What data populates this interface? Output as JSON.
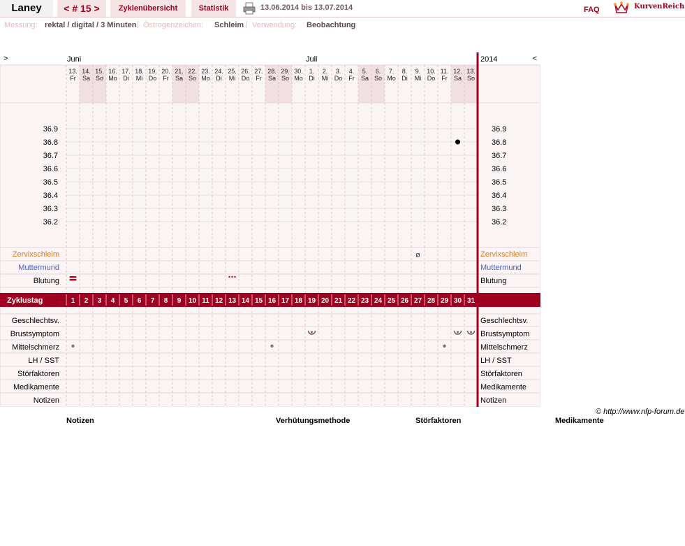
{
  "header": {
    "user_name": "Laney",
    "cycle_nav": "< # 15 >",
    "cycle_overview": "Zyklenübersicht",
    "statistics": "Statistik",
    "date_range": "13.06.2014 bis 13.07.2014",
    "faq": "FAQ",
    "brand": "KurvenReich"
  },
  "meta": {
    "measurement_label": "Messung:",
    "measurement_value": "rektal / digital / 3 Minuten",
    "estrogen_label": "Östrogenzeichen:",
    "estrogen_value": "Schleim",
    "usage_label": "Verwendung:",
    "usage_value": "Beobachtung"
  },
  "chart": {
    "nav_prev": ">",
    "nav_next": "<",
    "year": "2014",
    "months": [
      {
        "label": "Juni",
        "col": 0
      },
      {
        "label": "Juli",
        "col": 18
      }
    ],
    "days": [
      {
        "d": "13.",
        "w": "Fr"
      },
      {
        "d": "14.",
        "w": "Sa"
      },
      {
        "d": "15.",
        "w": "So"
      },
      {
        "d": "16.",
        "w": "Mo"
      },
      {
        "d": "17.",
        "w": "Di"
      },
      {
        "d": "18.",
        "w": "Mi"
      },
      {
        "d": "19.",
        "w": "Do"
      },
      {
        "d": "20.",
        "w": "Fr"
      },
      {
        "d": "21.",
        "w": "Sa"
      },
      {
        "d": "22.",
        "w": "So"
      },
      {
        "d": "23.",
        "w": "Mo"
      },
      {
        "d": "24.",
        "w": "Di"
      },
      {
        "d": "25.",
        "w": "Mi"
      },
      {
        "d": "26.",
        "w": "Do"
      },
      {
        "d": "27.",
        "w": "Fr"
      },
      {
        "d": "28.",
        "w": "Sa"
      },
      {
        "d": "29.",
        "w": "So"
      },
      {
        "d": "30.",
        "w": "Mo"
      },
      {
        "d": "1.",
        "w": "Di"
      },
      {
        "d": "2.",
        "w": "Mi"
      },
      {
        "d": "3.",
        "w": "Do"
      },
      {
        "d": "4.",
        "w": "Fr"
      },
      {
        "d": "5.",
        "w": "Sa"
      },
      {
        "d": "6.",
        "w": "So"
      },
      {
        "d": "7.",
        "w": "Mo"
      },
      {
        "d": "8.",
        "w": "Di"
      },
      {
        "d": "9.",
        "w": "Mi"
      },
      {
        "d": "10.",
        "w": "Do"
      },
      {
        "d": "11.",
        "w": "Fr"
      },
      {
        "d": "12.",
        "w": "Sa"
      },
      {
        "d": "13.",
        "w": "So"
      }
    ],
    "temperature_ticks": [
      "36.9",
      "36.8",
      "36.7",
      "36.6",
      "36.5",
      "36.4",
      "36.3",
      "36.2"
    ],
    "row_labels": {
      "cervical_mucus": "Zervixschleim",
      "cervix": "Muttermund",
      "bleeding": "Blutung",
      "cycle_day": "Zyklustag",
      "intercourse": "Geschlechtsv.",
      "breast_symptom": "Brustsymptom",
      "mittelschmerz": "Mittelschmerz",
      "lh_test": "LH / SST",
      "disturbances": "Störfaktoren",
      "medication": "Medikamente",
      "notes": "Notizen"
    },
    "cycle_day_numbers": [
      "1",
      "2",
      "3",
      "4",
      "5",
      "6",
      "7",
      "8",
      "9",
      "10",
      "11",
      "12",
      "13",
      "14",
      "15",
      "16",
      "17",
      "18",
      "19",
      "20",
      "21",
      "22",
      "23",
      "24",
      "25",
      "26",
      "27",
      "28",
      "29",
      "30",
      "31"
    ],
    "colors": {
      "accent": "#a00020",
      "weekend": "#f2dfe1",
      "mucus_label": "#e07a1a",
      "cervix_label": "#4a5ac8",
      "background": "#fbf4f4"
    }
  },
  "chart_data": {
    "type": "scatter",
    "x": [
      30
    ],
    "y": [
      36.8
    ],
    "ylim": [
      36.1,
      37.0
    ],
    "xlabel": "",
    "ylabel": "",
    "markers": {
      "bleeding_heavy_day": 1,
      "bleeding_spotting_day": 13,
      "cervical_mucus_symbol_day": 27,
      "cervical_mucus_symbol": "ø",
      "breast_symptom_days": [
        19,
        30,
        31
      ],
      "mittelschmerz_days": [
        1,
        16,
        29
      ]
    }
  },
  "footer": {
    "copyright": "© http://www.nfp-forum.de",
    "legend": [
      "Notizen",
      "Verhütungsmethode",
      "Störfaktoren",
      "Medikamente"
    ]
  }
}
